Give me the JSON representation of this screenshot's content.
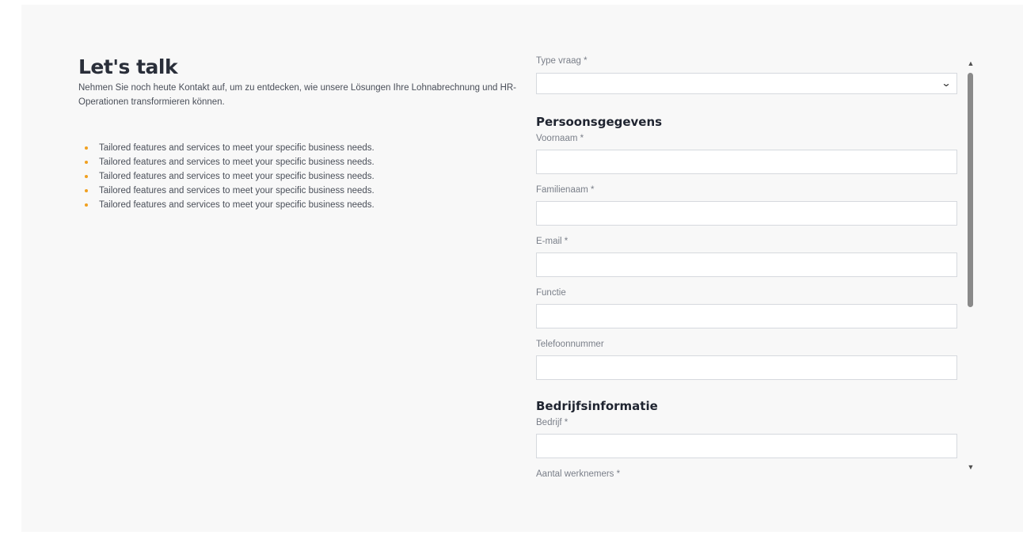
{
  "intro": {
    "title": "Let's talk",
    "text": "Nehmen Sie noch heute Kontakt auf, um zu entdecken, wie unsere Lösungen Ihre Lohnabrechnung und HR-Operationen transformieren können.",
    "bullets": [
      "Tailored features and services to meet your specific business needs.",
      "Tailored features and services to meet your specific business needs.",
      "Tailored features and services to meet your specific business needs.",
      "Tailored features and services to meet your specific business needs.",
      "Tailored features and services to meet your specific business needs."
    ],
    "bullet_color": "#f0a020"
  },
  "form": {
    "type_label": "Type vraag *",
    "type_value": "",
    "personal_heading": "Persoonsgegevens",
    "first_name_label": "Voornaam *",
    "last_name_label": "Familienaam *",
    "email_label": "E-mail *",
    "function_label": "Functie",
    "phone_label": "Telefoonnummer",
    "company_heading": "Bedrijfsinformatie",
    "company_label": "Bedrijf *",
    "employees_label": "Aantal werknemers *"
  },
  "icons": {
    "select_chevron": "chevron-down-icon",
    "scroll_up": "scroll-up-arrow-icon",
    "scroll_down": "scroll-down-arrow-icon"
  }
}
